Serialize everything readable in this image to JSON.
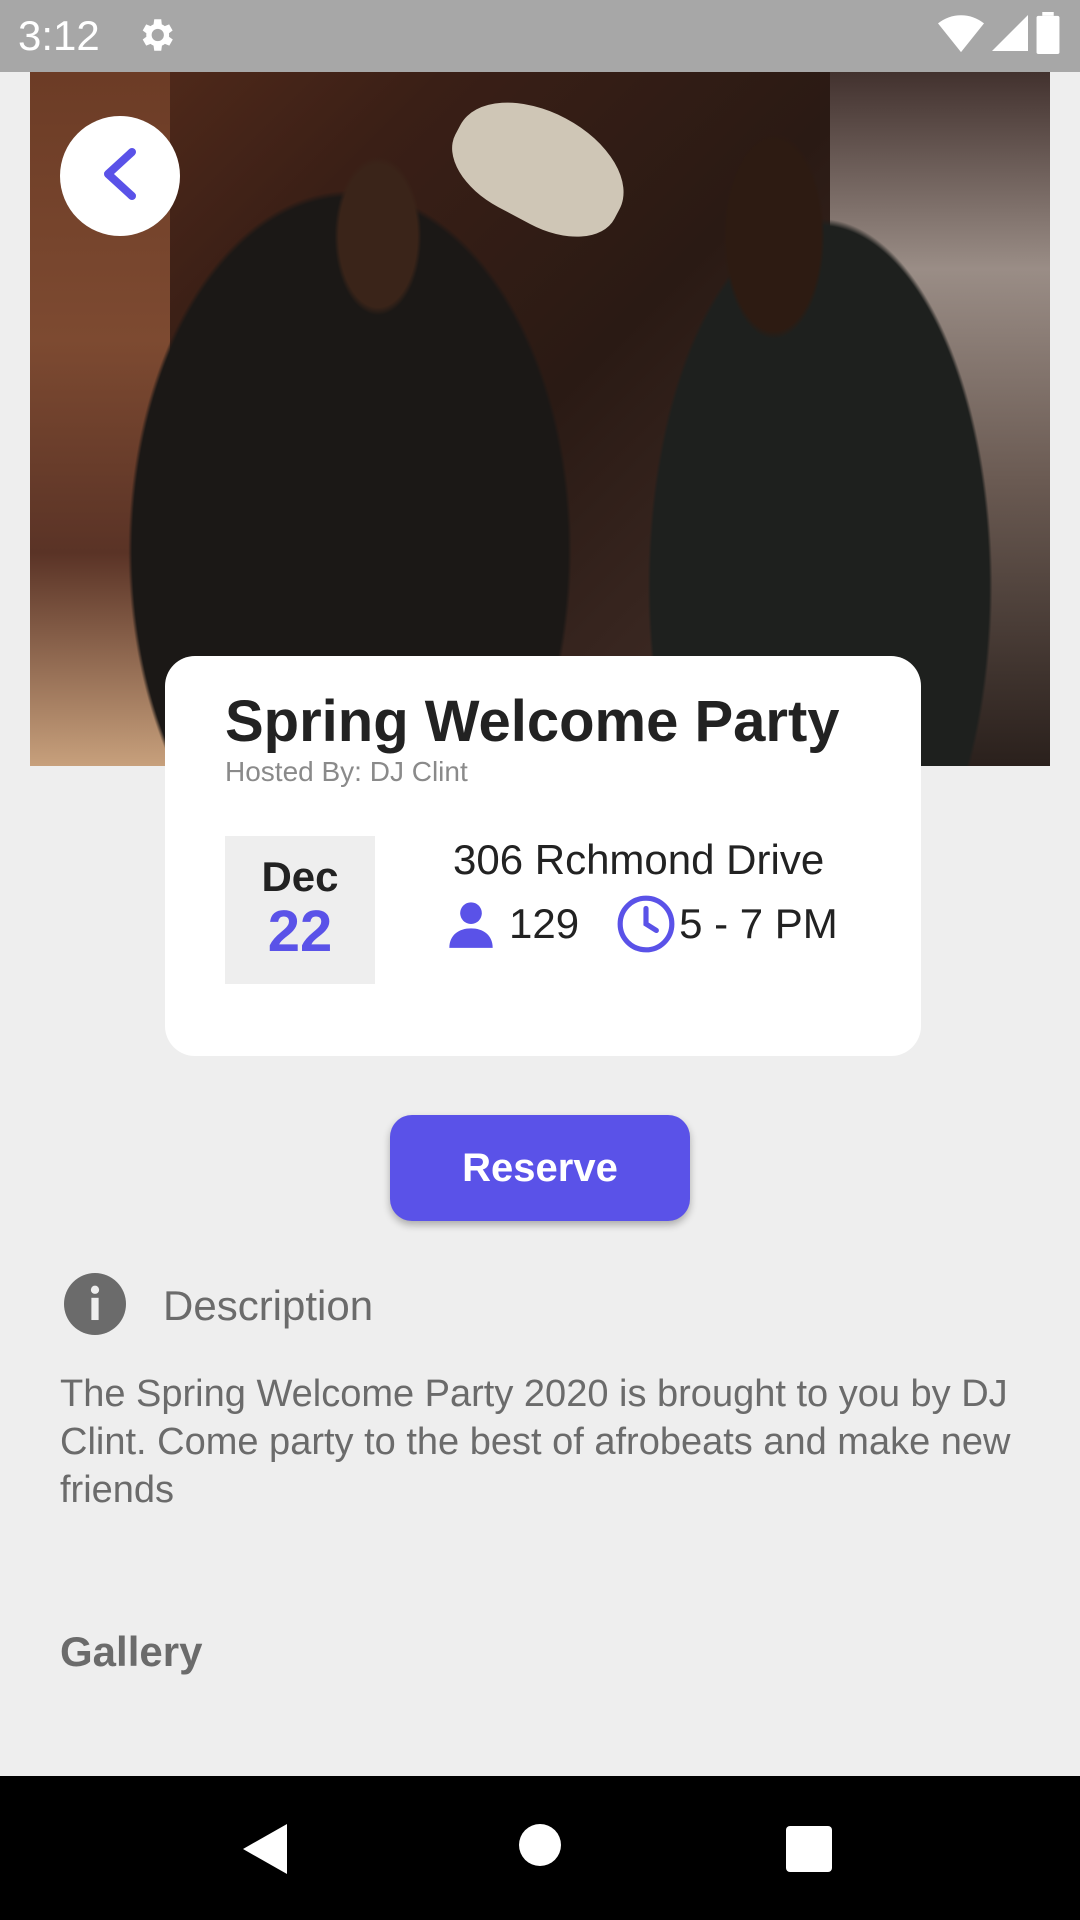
{
  "status_bar": {
    "time": "3:12",
    "icons": [
      "gear-icon",
      "wifi-icon",
      "cell-signal-icon",
      "battery-icon"
    ]
  },
  "hero": {
    "image": "party-photo-two-men"
  },
  "back_button": {
    "icon": "chevron-left-icon"
  },
  "event": {
    "title": "Spring Welcome Party",
    "host": "Hosted By: DJ Clint",
    "date": {
      "month": "Dec",
      "day": "22"
    },
    "address": "306 Rchmond Drive",
    "attendees": "129",
    "time": "5 - 7 PM"
  },
  "reserve": {
    "label": "Reserve"
  },
  "description": {
    "title": "Description",
    "text": "The Spring Welcome Party 2020 is brought to you by DJ Clint. Come party to the best of afrobeats and make new friends"
  },
  "gallery": {
    "title": "Gallery"
  },
  "nav_bar": {
    "buttons": [
      "back-triangle-icon",
      "home-circle-icon",
      "recents-square-icon"
    ]
  },
  "colors": {
    "accent": "#5a52e8",
    "background": "#eeeeee",
    "status_bar": "#a7a7a7",
    "nav_bar": "#000000",
    "muted_text": "#6b6b6b"
  }
}
